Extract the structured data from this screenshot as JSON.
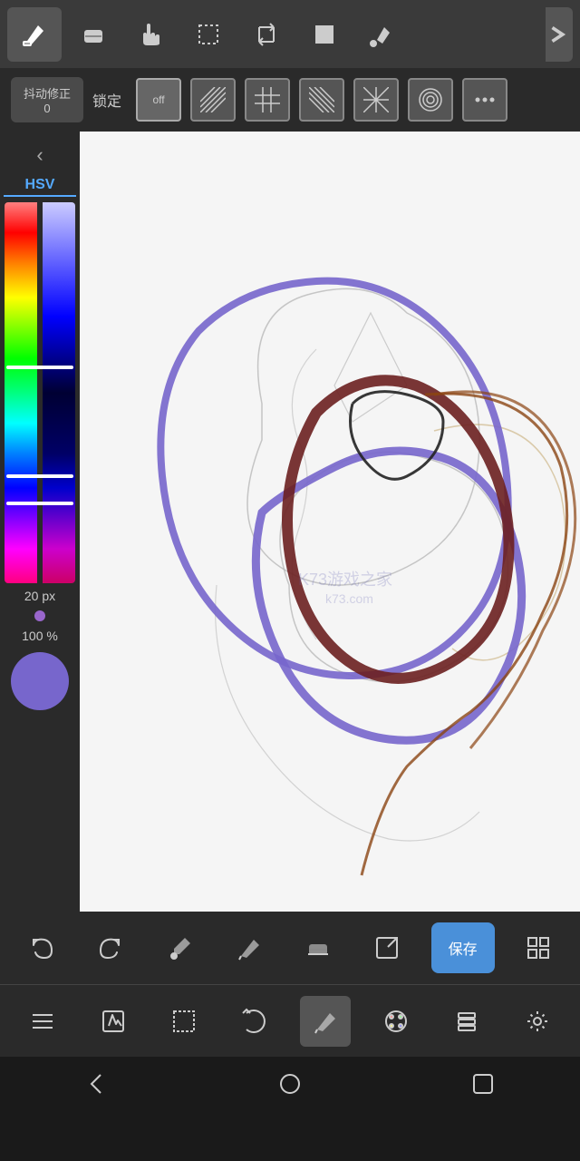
{
  "topToolbar": {
    "tools": [
      {
        "name": "pencil",
        "label": "✏",
        "active": true
      },
      {
        "name": "eraser",
        "label": "◻"
      },
      {
        "name": "hand",
        "label": "✋"
      },
      {
        "name": "select-rect",
        "label": "□"
      },
      {
        "name": "transform",
        "label": "⬡"
      },
      {
        "name": "fill-rect",
        "label": "■"
      },
      {
        "name": "fill-bucket",
        "label": "⬟"
      }
    ],
    "expand_label": "›"
  },
  "stabilizerBar": {
    "stab_label": "抖动修正",
    "stab_value": "0",
    "lock_label": "锁定",
    "lock_off_label": "off",
    "patterns": [
      "diagonal1",
      "grid",
      "diagonal2",
      "radial-lines",
      "concentric",
      "more"
    ]
  },
  "colorPanel": {
    "hsv_label": "HSV",
    "size_label": "20 px",
    "opacity_label": "100 %",
    "back_icon": "‹"
  },
  "bottomToolbar": {
    "buttons": [
      {
        "name": "undo",
        "label": "undo"
      },
      {
        "name": "redo",
        "label": "redo"
      },
      {
        "name": "eyedropper",
        "label": "eyedropper"
      },
      {
        "name": "pencil2",
        "label": "pencil"
      },
      {
        "name": "eraser2",
        "label": "eraser"
      },
      {
        "name": "export",
        "label": "export"
      }
    ],
    "save_label": "保存",
    "grid_label": "grid"
  },
  "bottomToolbar2": {
    "buttons": [
      {
        "name": "menu",
        "label": "menu"
      },
      {
        "name": "edit",
        "label": "edit"
      },
      {
        "name": "select",
        "label": "select"
      },
      {
        "name": "rotate",
        "label": "rotate"
      },
      {
        "name": "brush",
        "label": "brush",
        "active": true
      },
      {
        "name": "palette",
        "label": "palette"
      },
      {
        "name": "layers",
        "label": "layers"
      },
      {
        "name": "settings",
        "label": "settings"
      }
    ]
  },
  "navBar": {
    "back_label": "◁",
    "home_label": "○",
    "recent_label": "□"
  },
  "watermark": "K73游戏之家\nk73.com"
}
